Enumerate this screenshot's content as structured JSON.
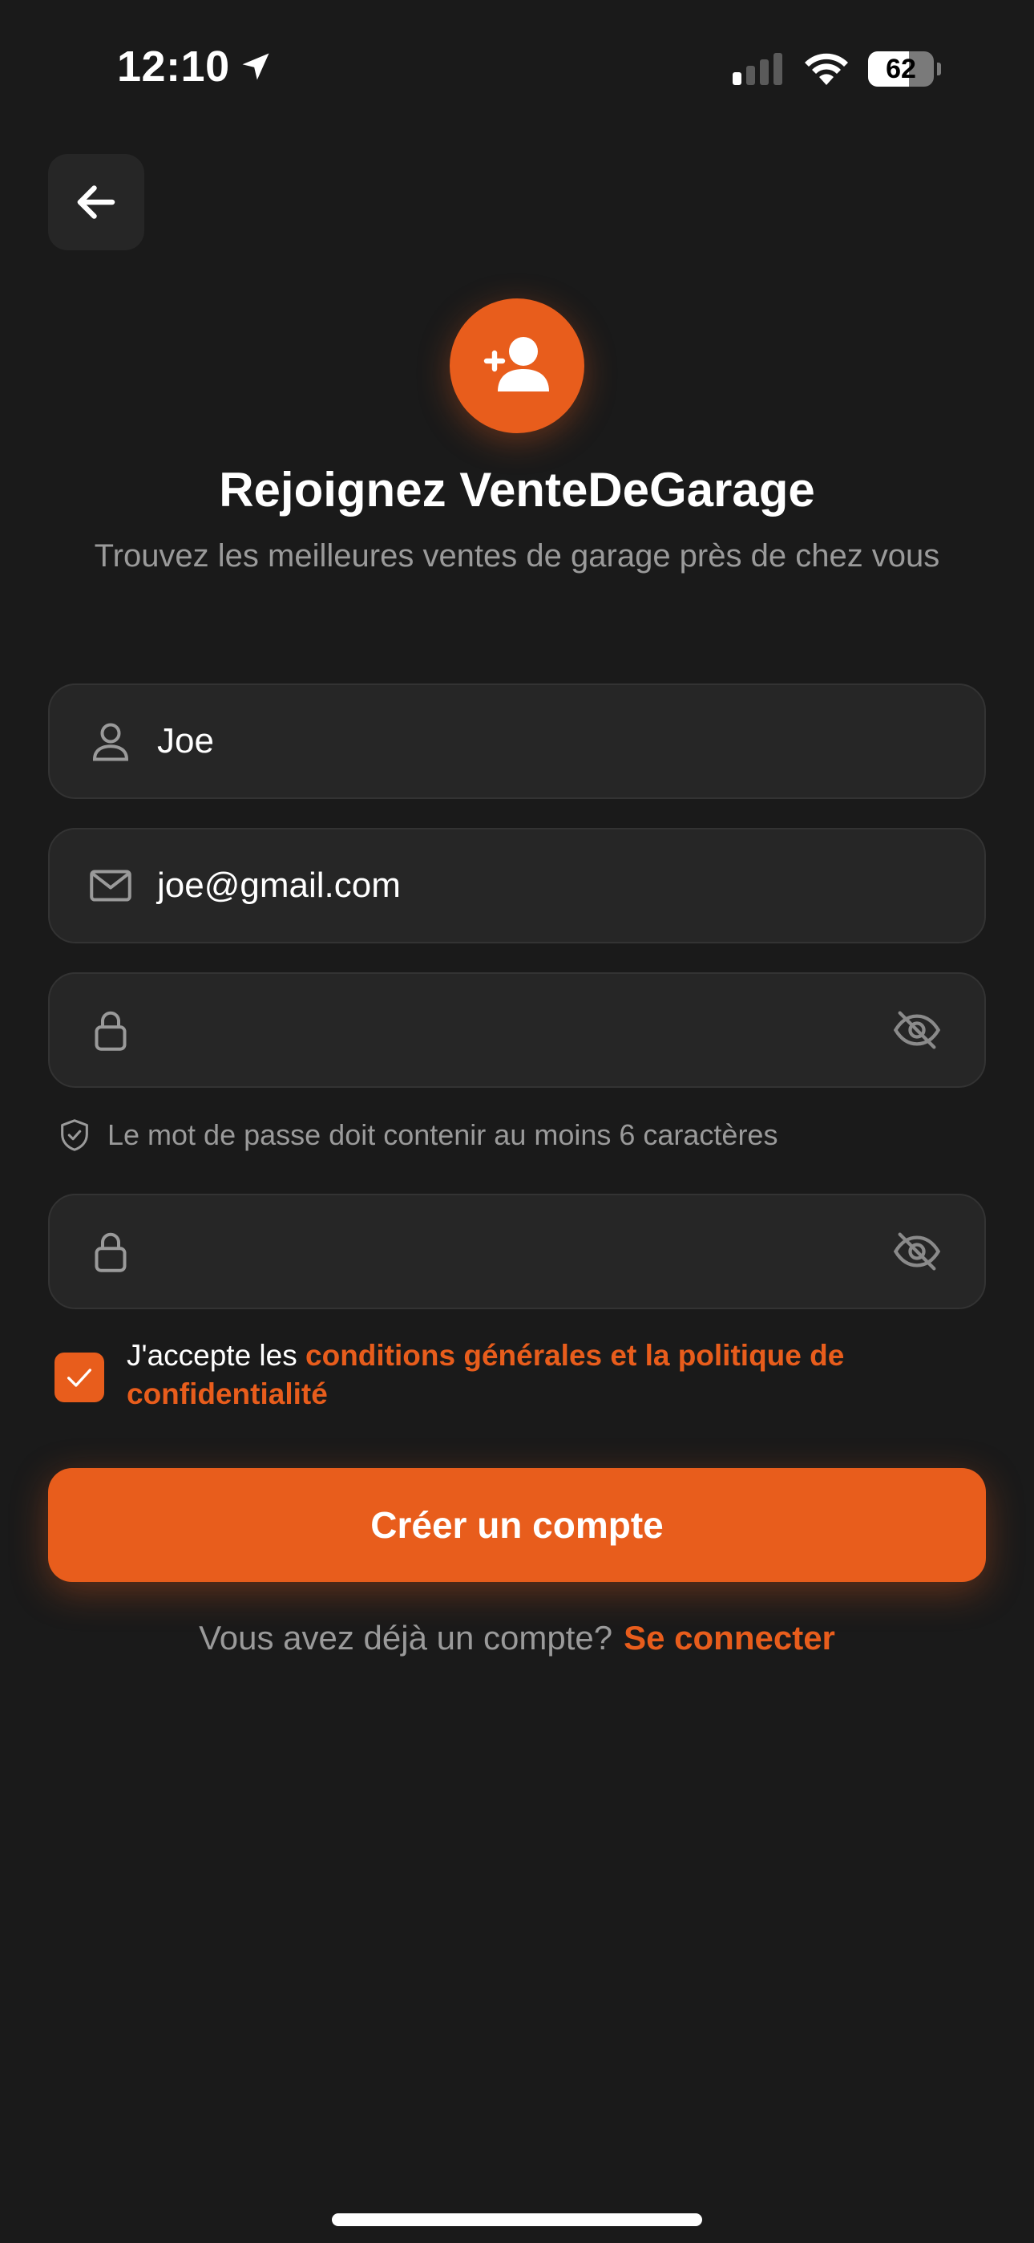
{
  "status_bar": {
    "time": "12:10",
    "battery_level": "62",
    "battery_percent": 62,
    "signal_bars_on": 1,
    "signal_bars_total": 4
  },
  "header": {
    "title": "Rejoignez VenteDeGarage",
    "subtitle": "Trouvez les meilleures ventes de garage près de chez vous"
  },
  "form": {
    "name_value": "Joe",
    "email_value": "joe@gmail.com",
    "password_value": "",
    "confirm_password_value": "",
    "password_hint": "Le mot de passe doit contenir au moins 6 caractères",
    "terms_checked": true,
    "terms_prefix": "J'accepte les ",
    "terms_link": "conditions générales et la politique de confidentialité",
    "submit_label": "Créer un compte"
  },
  "footer": {
    "has_account_text": "Vous avez déjà un compte?",
    "login_link": "Se connecter"
  },
  "colors": {
    "background": "#1a1a1a",
    "accent": "#e85d1c",
    "field_bg": "#262626",
    "muted_text": "#9a9a9a"
  },
  "icons": {
    "back": "arrow-left-icon",
    "avatar": "user-plus-icon",
    "name": "user-icon",
    "email": "mail-icon",
    "password": "lock-icon",
    "toggle": "eye-off-icon",
    "hint": "shield-check-icon",
    "checkbox": "check-icon"
  }
}
